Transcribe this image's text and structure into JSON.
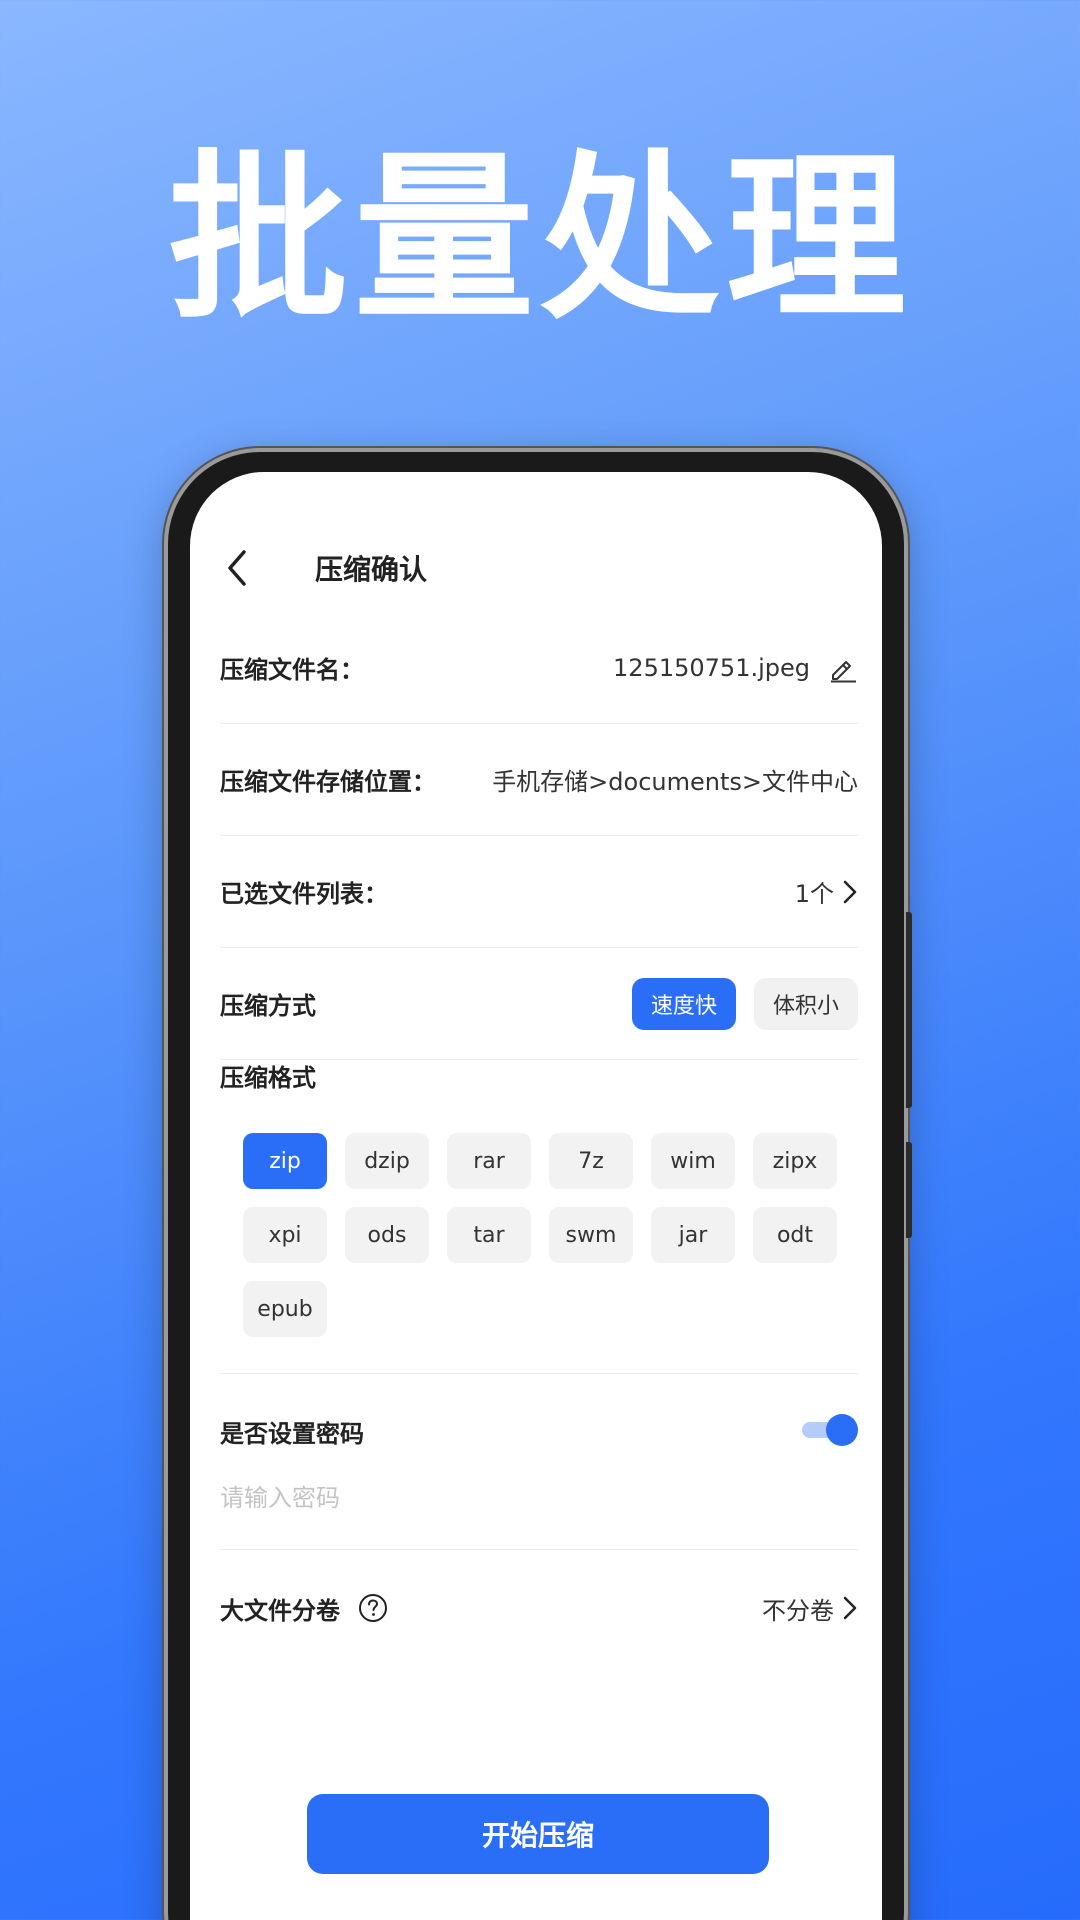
{
  "headline": "批量处理",
  "header": {
    "title": "压缩确认",
    "back_icon": "chevron-left-icon"
  },
  "filename": {
    "label": "压缩文件名：",
    "value": "125150751.jpeg",
    "icon": "pencil-icon"
  },
  "location": {
    "label": "压缩文件存储位置：",
    "value": "手机存储>documents>文件中心"
  },
  "selected": {
    "label": "已选文件列表：",
    "value": "1个",
    "icon": "chevron-right-icon"
  },
  "method": {
    "label": "压缩方式",
    "options": [
      "速度快",
      "体积小"
    ],
    "selected": "速度快"
  },
  "format": {
    "label": "压缩格式",
    "options": [
      "zip",
      "dzip",
      "rar",
      "7z",
      "wim",
      "zipx",
      "xpi",
      "ods",
      "tar",
      "swm",
      "jar",
      "odt",
      "epub"
    ],
    "selected": "zip"
  },
  "password": {
    "label": "是否设置密码",
    "enabled": true,
    "placeholder": "请输入密码"
  },
  "split": {
    "label": "大文件分卷",
    "value": "不分卷",
    "help_icon": "question-circle-icon"
  },
  "start_button": "开始压缩",
  "colors": {
    "accent": "#2a6ef8",
    "toggle_track": "#b4ccfb",
    "chip_bg": "#f2f2f2"
  }
}
